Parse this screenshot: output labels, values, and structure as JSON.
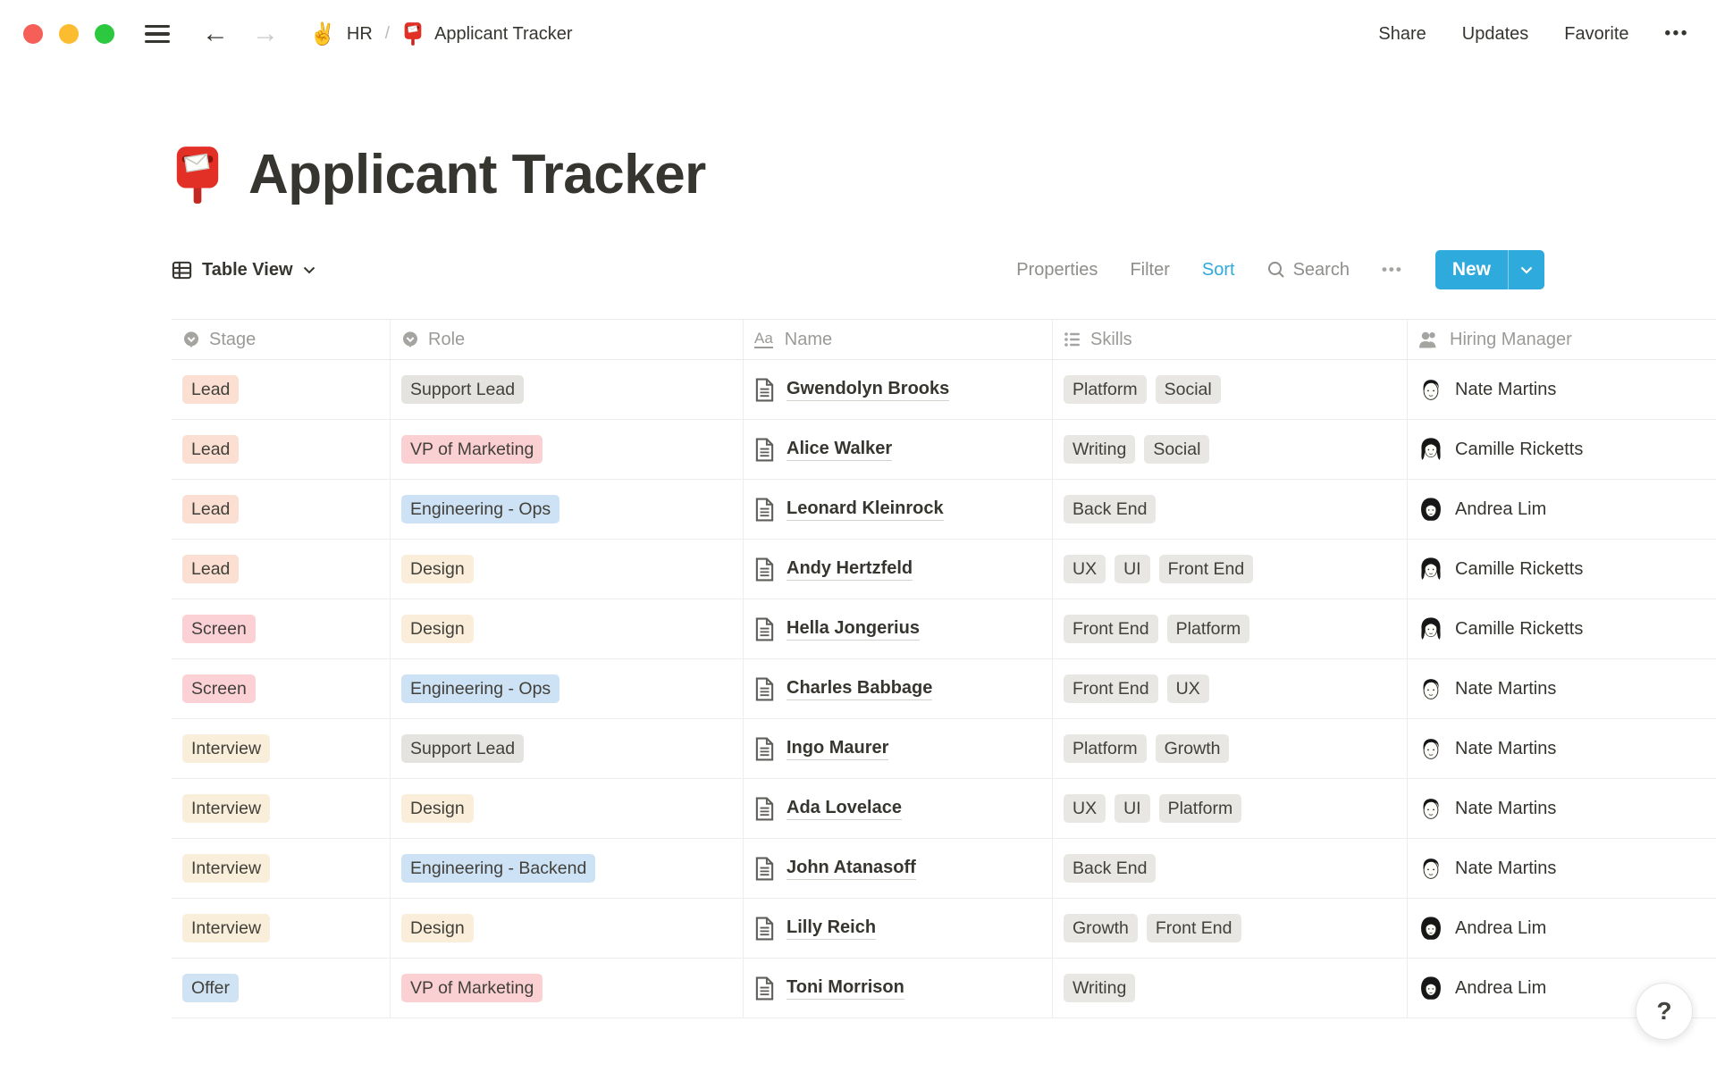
{
  "topbar": {
    "breadcrumb": {
      "workspace_emoji": "✌️",
      "workspace": "HR",
      "separator": "/",
      "page": "Applicant Tracker"
    },
    "actions": {
      "share": "Share",
      "updates": "Updates",
      "favorite": "Favorite",
      "more_glyph": "•••"
    }
  },
  "page": {
    "icon": "red-mailbox-emoji",
    "title": "Applicant Tracker"
  },
  "toolbar": {
    "view": "Table View",
    "properties": "Properties",
    "filter": "Filter",
    "sort": "Sort",
    "search": "Search",
    "more_glyph": "•••",
    "new": "New",
    "accent": "#2eaadc",
    "sort_active_color": "#2eaadc"
  },
  "table": {
    "columns": [
      {
        "label": "Stage",
        "icon": "select-icon"
      },
      {
        "label": "Role",
        "icon": "select-icon"
      },
      {
        "label": "Name",
        "icon": "text-icon",
        "text_icon_glyph": "Aa"
      },
      {
        "label": "Skills",
        "icon": "list-icon"
      },
      {
        "label": "Hiring Manager",
        "icon": "person-icon"
      }
    ],
    "tag_colors": {
      "stage": {
        "Lead": "#fadfd2",
        "Screen": "#fbd1d5",
        "Interview": "#f9eeda",
        "Offer": "#cfe3f4"
      },
      "role": {
        "Support Lead": "#e4e3e0",
        "VP of Marketing": "#fbd0d2",
        "Engineering - Ops": "#cde2f4",
        "Engineering - Backend": "#cde2f4",
        "Design": "#faeeda"
      },
      "skill_bg": "#e8e7e4"
    },
    "avatar_styles": {
      "Nate Martins": "short-dark-hair-man",
      "Camille Ricketts": "parted-hair-woman",
      "Andrea Lim": "bob-hair-woman"
    },
    "rows": [
      {
        "stage": "Lead",
        "role": "Support Lead",
        "name": "Gwendolyn Brooks",
        "skills": [
          "Platform",
          "Social"
        ],
        "manager": "Nate Martins"
      },
      {
        "stage": "Lead",
        "role": "VP of Marketing",
        "name": "Alice Walker",
        "skills": [
          "Writing",
          "Social"
        ],
        "manager": "Camille Ricketts"
      },
      {
        "stage": "Lead",
        "role": "Engineering - Ops",
        "name": "Leonard Kleinrock",
        "skills": [
          "Back End"
        ],
        "manager": "Andrea Lim"
      },
      {
        "stage": "Lead",
        "role": "Design",
        "name": "Andy Hertzfeld",
        "skills": [
          "UX",
          "UI",
          "Front End"
        ],
        "manager": "Camille Ricketts"
      },
      {
        "stage": "Screen",
        "role": "Design",
        "name": "Hella Jongerius",
        "skills": [
          "Front End",
          "Platform"
        ],
        "manager": "Camille Ricketts"
      },
      {
        "stage": "Screen",
        "role": "Engineering - Ops",
        "name": "Charles Babbage",
        "skills": [
          "Front End",
          "UX"
        ],
        "manager": "Nate Martins"
      },
      {
        "stage": "Interview",
        "role": "Support Lead",
        "name": "Ingo Maurer",
        "skills": [
          "Platform",
          "Growth"
        ],
        "manager": "Nate Martins"
      },
      {
        "stage": "Interview",
        "role": "Design",
        "name": "Ada Lovelace",
        "skills": [
          "UX",
          "UI",
          "Platform"
        ],
        "manager": "Nate Martins"
      },
      {
        "stage": "Interview",
        "role": "Engineering - Backend",
        "name": "John Atanasoff",
        "skills": [
          "Back End"
        ],
        "manager": "Nate Martins"
      },
      {
        "stage": "Interview",
        "role": "Design",
        "name": "Lilly Reich",
        "skills": [
          "Growth",
          "Front End"
        ],
        "manager": "Andrea Lim"
      },
      {
        "stage": "Offer",
        "role": "VP of Marketing",
        "name": "Toni Morrison",
        "skills": [
          "Writing"
        ],
        "manager": "Andrea Lim"
      }
    ]
  },
  "help": {
    "label": "?"
  }
}
